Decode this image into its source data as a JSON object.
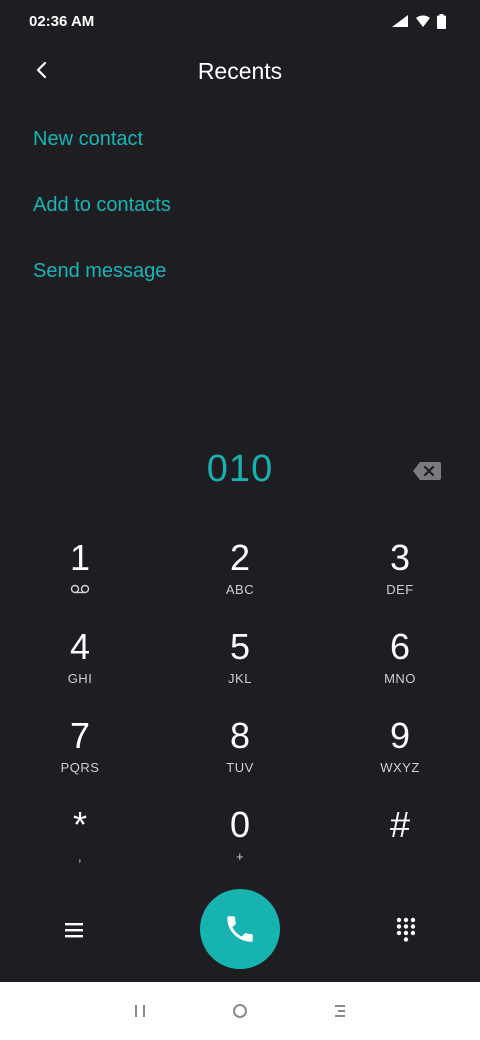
{
  "status_bar": {
    "time": "02:36 AM"
  },
  "header": {
    "title": "Recents"
  },
  "actions": [
    {
      "label": "New contact"
    },
    {
      "label": "Add to contacts"
    },
    {
      "label": "Send message"
    }
  ],
  "dialer": {
    "number": "010",
    "keys": [
      {
        "digit": "1",
        "letters": ""
      },
      {
        "digit": "2",
        "letters": "ABC"
      },
      {
        "digit": "3",
        "letters": "DEF"
      },
      {
        "digit": "4",
        "letters": "GHI"
      },
      {
        "digit": "5",
        "letters": "JKL"
      },
      {
        "digit": "6",
        "letters": "MNO"
      },
      {
        "digit": "7",
        "letters": "PQRS"
      },
      {
        "digit": "8",
        "letters": "TUV"
      },
      {
        "digit": "9",
        "letters": "WXYZ"
      },
      {
        "digit": "*",
        "letters": ","
      },
      {
        "digit": "0",
        "letters": "+"
      },
      {
        "digit": "#",
        "letters": ""
      }
    ]
  },
  "colors": {
    "accent": "#17b3b1",
    "background": "#1e1e22"
  },
  "icons": [
    "signal-icon",
    "wifi-icon",
    "battery-icon",
    "back-arrow-icon",
    "backspace-icon",
    "voicemail-icon",
    "menu-icon",
    "phone-icon",
    "dialpad-icon",
    "recents-nav-icon",
    "home-nav-icon",
    "back-nav-icon"
  ]
}
